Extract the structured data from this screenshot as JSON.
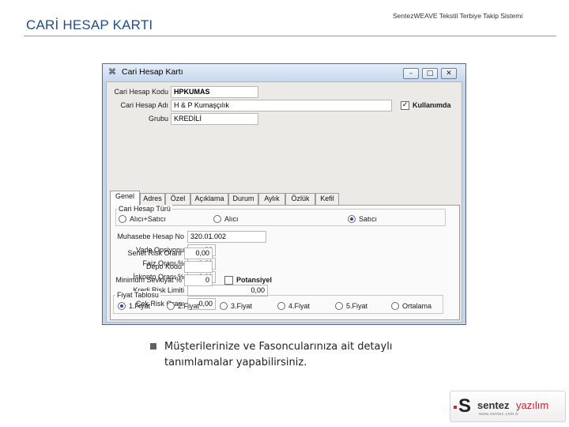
{
  "slide": {
    "title": "CARİ HESAP KARTI",
    "subtitle": "SentezWEAVE  Tekstil Terbiye Takip Sistemi"
  },
  "window": {
    "title": "Cari Hesap Kartı",
    "minimize": "–",
    "maximize": "□",
    "close": "✕"
  },
  "header_form": {
    "code_label": "Cari Hesap Kodu",
    "code_value": "HPKUMAS",
    "name_label": "Cari Hesap Adı",
    "name_value": "H & P Kumaşçılık",
    "group_label": "Grubu",
    "group_value": "KREDİLİ",
    "in_use_label": "Kullanımda",
    "in_use_checked": true,
    "check_mark": "✓"
  },
  "tabs": [
    "Genel",
    "Adres",
    "Özel",
    "Açıklama",
    "Durum",
    "Aylık",
    "Özlük",
    "Kefil"
  ],
  "active_tab": "Genel",
  "general": {
    "account_type_caption": "Cari Hesap Türü",
    "account_types": [
      {
        "label": "Alıcı+Satıcı",
        "selected": false
      },
      {
        "label": "Alıcı",
        "selected": false
      },
      {
        "label": "Satıcı",
        "selected": true
      }
    ],
    "fields": [
      {
        "label": "Muhasebe Hesap No",
        "value": "320.01.002"
      },
      {
        "label": "Vade Opsiyonu",
        "value": "30"
      },
      {
        "label": "Faiz Oranı %",
        "value": "0,00"
      },
      {
        "label": "İskonto Oranı %",
        "value": "0,00"
      },
      {
        "label": "Kredi Risk Limiti",
        "value": "0,00"
      },
      {
        "label": "Çek Risk Oranı",
        "value": "0,00"
      },
      {
        "label": "Senet Risk Oranı",
        "value": "0,00"
      },
      {
        "label": "Depo Kodu",
        "value": ""
      },
      {
        "label": "Minimum Sevkiyat %",
        "value": "0"
      }
    ],
    "potential_label": "Potansiyel",
    "potential_checked": false,
    "price_table_caption": "Fiyat Tablosu",
    "price_options": [
      {
        "label": "1.Fiyat",
        "selected": true
      },
      {
        "label": "2.Fiyat",
        "selected": false
      },
      {
        "label": "3.Fiyat",
        "selected": false
      },
      {
        "label": "4.Fiyat",
        "selected": false
      },
      {
        "label": "5.Fiyat",
        "selected": false
      },
      {
        "label": "Ortalama",
        "selected": false
      }
    ]
  },
  "bullet_text": "Müşterilerinize ve Fasoncularınıza ait detaylı tanımlamalar yapabilirsiniz.",
  "logo": {
    "word1": "sentez",
    "word2": "yazılım",
    "url": "www.sentez.com.tr",
    "brand_red": "#c8262c"
  },
  "colors": {
    "title_blue": "#1f4e8c",
    "window_frame": "#c2d5ec",
    "form_bg": "#ebeae6"
  }
}
